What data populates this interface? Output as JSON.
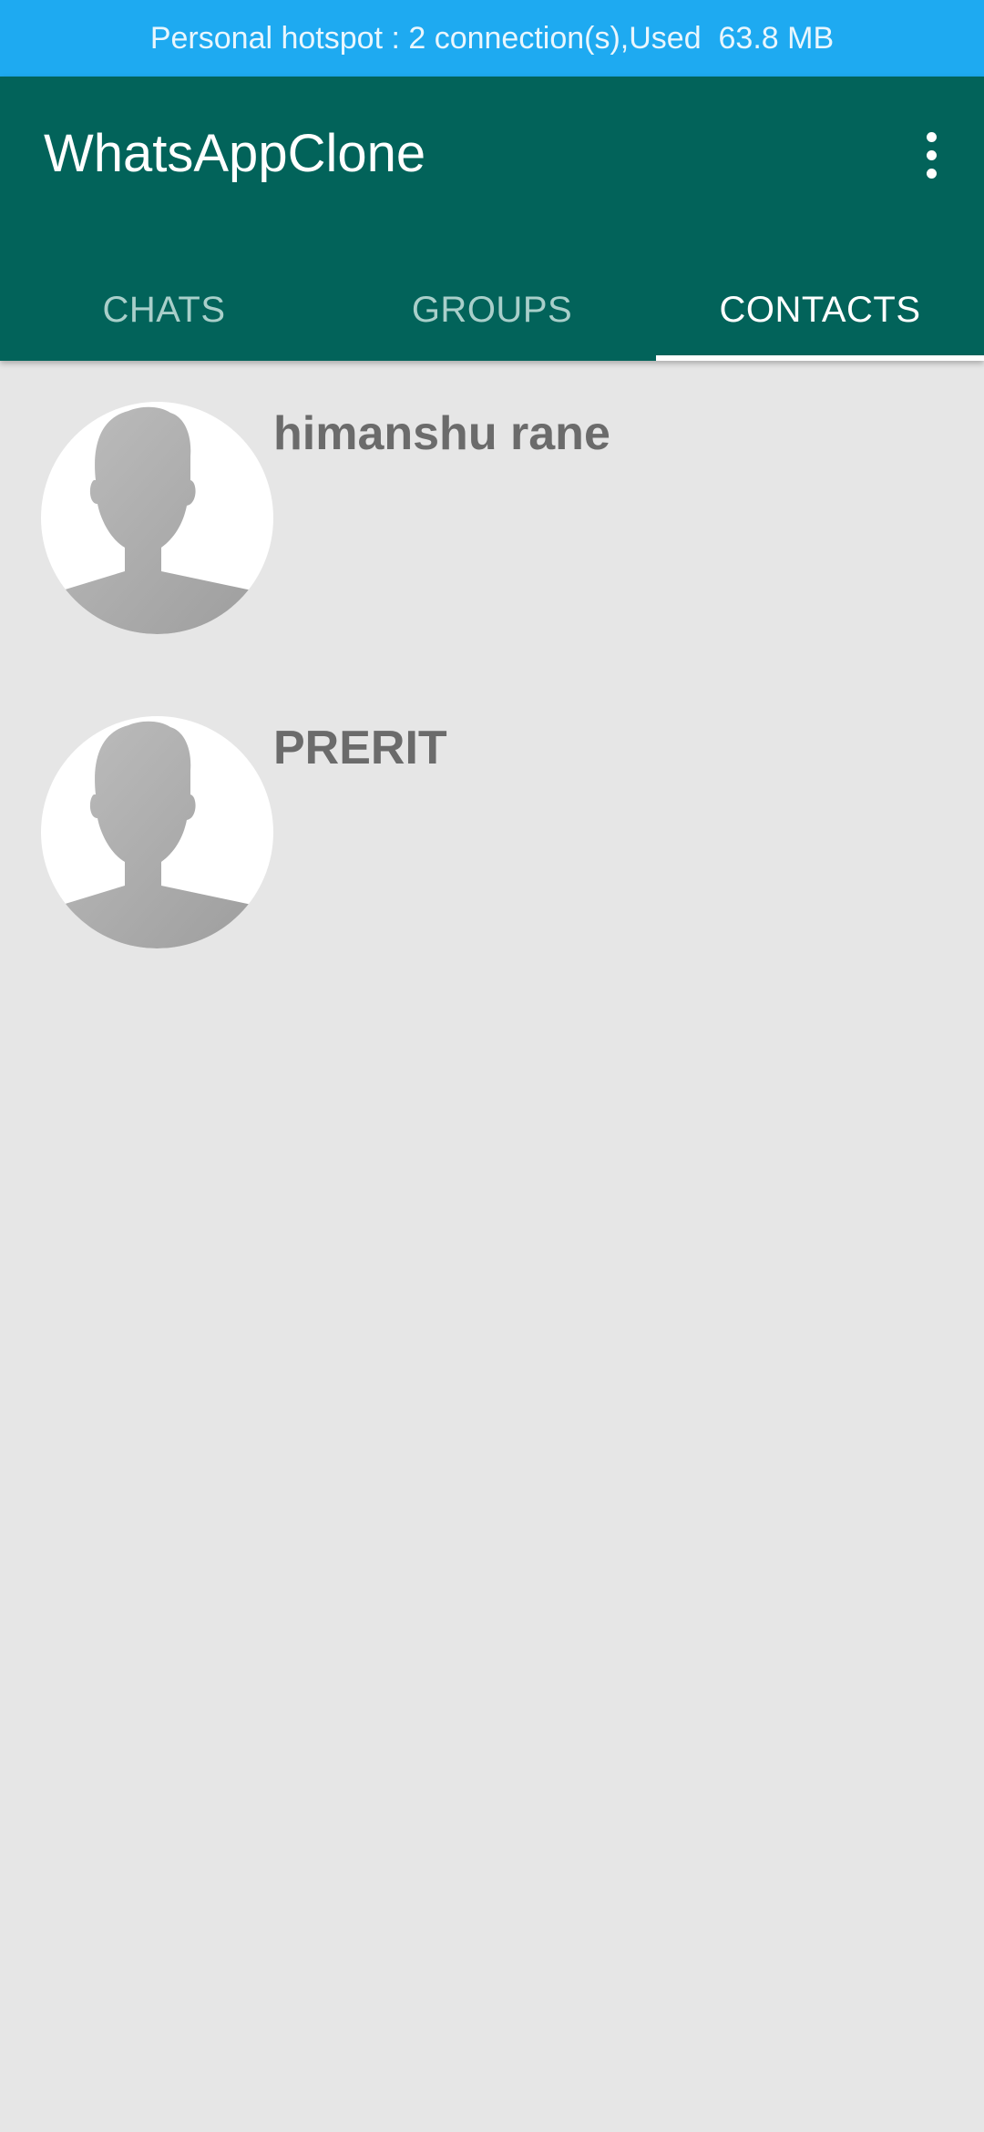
{
  "status_banner": {
    "text": "Personal hotspot : 2 connection(s),Used  63.8 MB"
  },
  "app_bar": {
    "title": "WhatsAppClone",
    "menu_icon": "more-vertical-icon"
  },
  "tabs": [
    {
      "label": "CHATS",
      "active": false
    },
    {
      "label": "GROUPS",
      "active": false
    },
    {
      "label": "CONTACTS",
      "active": true
    }
  ],
  "contacts": [
    {
      "name": "himanshu rane",
      "avatar_icon": "default-avatar-icon"
    },
    {
      "name": "PRERIT",
      "avatar_icon": "default-avatar-icon"
    }
  ],
  "colors": {
    "status_banner": "#1eaaf1",
    "app_bar": "#02635a",
    "background": "#e6e6e6",
    "active_tab": "#ffffff",
    "inactive_tab": "#a9cfca",
    "contact_name": "#6b6b6b"
  }
}
